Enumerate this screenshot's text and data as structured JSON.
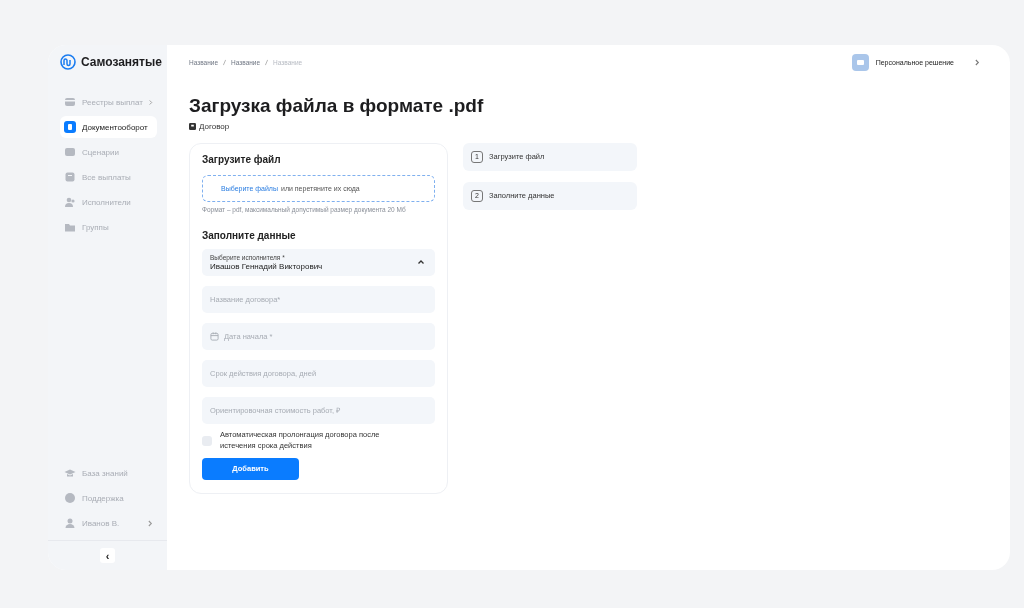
{
  "brand": {
    "name": "Самозанятые"
  },
  "sidebar": {
    "items": [
      {
        "label": "Реестры выплат",
        "selected": false,
        "expandable": true
      },
      {
        "label": "Документооборот",
        "selected": true,
        "expandable": false
      },
      {
        "label": "Сценарии",
        "selected": false,
        "expandable": false
      },
      {
        "label": "Все выплаты",
        "selected": false,
        "expandable": false
      },
      {
        "label": "Исполнители",
        "selected": false,
        "expandable": false
      },
      {
        "label": "Группы",
        "selected": false,
        "expandable": false
      }
    ],
    "bottom_items": [
      {
        "label": "База знаний",
        "expandable": false
      },
      {
        "label": "Поддержка",
        "expandable": false
      },
      {
        "label": "Иванов В.",
        "expandable": true
      }
    ],
    "collapse_button": "‹"
  },
  "breadcrumbs": [
    {
      "label": "Название",
      "current": false
    },
    {
      "label": "Название",
      "current": false
    },
    {
      "label": "Название",
      "current": true
    }
  ],
  "account": {
    "label": "Персональное решение"
  },
  "page": {
    "title": "Загрузка файла в формате .pdf",
    "subtitle": "Договор"
  },
  "upload": {
    "heading": "Загрузите файл",
    "link": "Выберите файлы",
    "text": "или перетяните их сюда",
    "hint": "Формат – pdf, максимальный допустимый размер документа 20 Мб"
  },
  "form": {
    "heading": "Заполните данные",
    "fields": [
      {
        "kind": "select",
        "label": "Выберите исполнителя *",
        "value": "Ивашов Геннадий Викторович",
        "expanded": true
      },
      {
        "kind": "text",
        "placeholder": "Название договора*"
      },
      {
        "kind": "date",
        "placeholder": "Дата начала *"
      },
      {
        "kind": "text",
        "placeholder": "Срок действия договора, дней"
      },
      {
        "kind": "text",
        "placeholder": "Ориентировочная стоимость работ, ₽"
      }
    ],
    "checkbox": {
      "label": "Автоматическая пролонгация договора после истечения срока действия",
      "checked": false
    },
    "submit": "Добавить"
  },
  "steps": [
    {
      "number": "1",
      "label": "Загрузите файл"
    },
    {
      "number": "2",
      "label": "Заполните данные"
    }
  ]
}
